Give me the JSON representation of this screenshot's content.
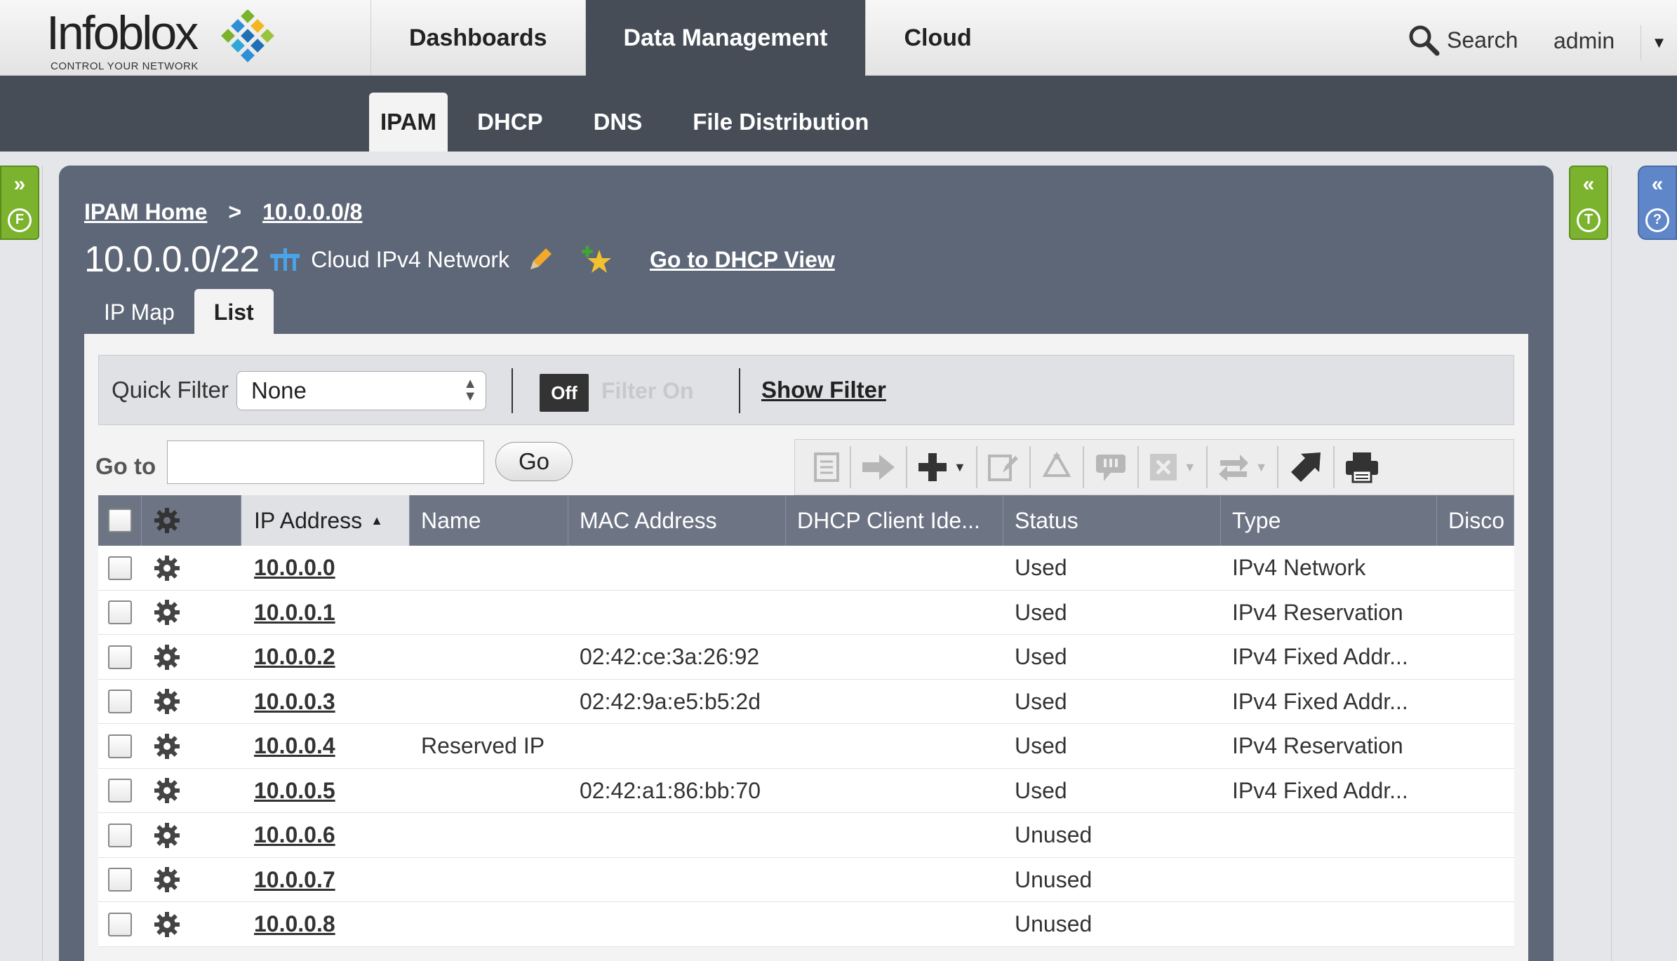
{
  "brand": {
    "name": "Infoblox",
    "tagline": "CONTROL YOUR NETWORK"
  },
  "main_nav": [
    {
      "label": "Dashboards",
      "active": false
    },
    {
      "label": "Data Management",
      "active": true
    },
    {
      "label": "Cloud",
      "active": false
    }
  ],
  "header": {
    "search_label": "Search",
    "user": "admin"
  },
  "sub_nav": [
    {
      "label": "IPAM",
      "active": true
    },
    {
      "label": "DHCP",
      "active": false
    },
    {
      "label": "DNS",
      "active": false
    },
    {
      "label": "File Distribution",
      "active": false
    }
  ],
  "side_rails": {
    "left_letter": "F",
    "right_letter": "T",
    "help_letter": "?"
  },
  "breadcrumb": {
    "home": "IPAM Home",
    "separator": ">",
    "current": "10.0.0.0/8"
  },
  "network": {
    "title": "10.0.0.0/22",
    "kind_label": "Cloud IPv4 Network",
    "dhcp_link": "Go to DHCP View"
  },
  "view_tabs": [
    {
      "label": "IP Map",
      "active": false
    },
    {
      "label": "List",
      "active": true
    }
  ],
  "filter": {
    "quick_filter_label": "Quick Filter",
    "quick_filter_value": "None",
    "toggle_off": "Off",
    "toggle_on": "Filter On",
    "show_filter": "Show Filter"
  },
  "goto": {
    "label": "Go to",
    "value": "",
    "button": "Go"
  },
  "toolbar_icons": [
    "open-icon",
    "next-icon",
    "add-icon",
    "edit-icon",
    "reclaim-icon",
    "comment-icon",
    "delete-icon",
    "transfer-icon",
    "export-icon",
    "print-icon"
  ],
  "table": {
    "columns": [
      "IP Address",
      "Name",
      "MAC Address",
      "DHCP Client Ide...",
      "Status",
      "Type",
      "Disco"
    ],
    "sorted_column": "IP Address",
    "rows": [
      {
        "ip": "10.0.0.0",
        "name": "",
        "mac": "",
        "dhcp": "",
        "status": "Used",
        "type": "IPv4 Network"
      },
      {
        "ip": "10.0.0.1",
        "name": "",
        "mac": "",
        "dhcp": "",
        "status": "Used",
        "type": "IPv4 Reservation"
      },
      {
        "ip": "10.0.0.2",
        "name": "",
        "mac": "02:42:ce:3a:26:92",
        "dhcp": "",
        "status": "Used",
        "type": "IPv4 Fixed Addr..."
      },
      {
        "ip": "10.0.0.3",
        "name": "",
        "mac": "02:42:9a:e5:b5:2d",
        "dhcp": "",
        "status": "Used",
        "type": "IPv4 Fixed Addr..."
      },
      {
        "ip": "10.0.0.4",
        "name": "Reserved IP",
        "mac": "",
        "dhcp": "",
        "status": "Used",
        "type": "IPv4 Reservation"
      },
      {
        "ip": "10.0.0.5",
        "name": "",
        "mac": "02:42:a1:86:bb:70",
        "dhcp": "",
        "status": "Used",
        "type": "IPv4 Fixed Addr..."
      },
      {
        "ip": "10.0.0.6",
        "name": "",
        "mac": "",
        "dhcp": "",
        "status": "Unused",
        "type": ""
      },
      {
        "ip": "10.0.0.7",
        "name": "",
        "mac": "",
        "dhcp": "",
        "status": "Unused",
        "type": ""
      },
      {
        "ip": "10.0.0.8",
        "name": "",
        "mac": "",
        "dhcp": "",
        "status": "Unused",
        "type": ""
      }
    ]
  },
  "colors": {
    "header_dark": "#474d57",
    "panel": "#5e6778",
    "rail_green": "#7bb32e",
    "rail_blue": "#5f86c8",
    "grid_head": "#6d7585"
  }
}
